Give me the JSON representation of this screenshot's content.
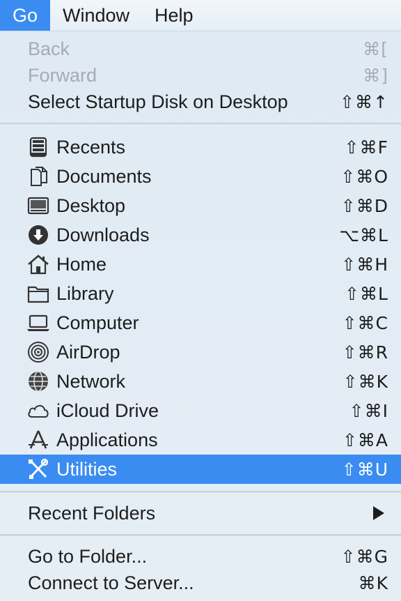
{
  "menubar": {
    "items": [
      "Go",
      "Window",
      "Help"
    ]
  },
  "menu": {
    "top_items": [
      {
        "label": "Back",
        "shortcut": "⌘[",
        "enabled": false
      },
      {
        "label": "Forward",
        "shortcut": "⌘]",
        "enabled": false
      },
      {
        "label": "Select Startup Disk on Desktop",
        "shortcut": "⇧⌘↑",
        "enabled": true
      }
    ],
    "places": [
      {
        "label": "Recents",
        "shortcut": "⇧⌘F",
        "icon": "recents-icon"
      },
      {
        "label": "Documents",
        "shortcut": "⇧⌘O",
        "icon": "documents-icon"
      },
      {
        "label": "Desktop",
        "shortcut": "⇧⌘D",
        "icon": "desktop-icon"
      },
      {
        "label": "Downloads",
        "shortcut": "⌥⌘L",
        "icon": "downloads-icon"
      },
      {
        "label": "Home",
        "shortcut": "⇧⌘H",
        "icon": "home-icon"
      },
      {
        "label": "Library",
        "shortcut": "⇧⌘L",
        "icon": "folder-icon"
      },
      {
        "label": "Computer",
        "shortcut": "⇧⌘C",
        "icon": "computer-icon"
      },
      {
        "label": "AirDrop",
        "shortcut": "⇧⌘R",
        "icon": "airdrop-icon"
      },
      {
        "label": "Network",
        "shortcut": "⇧⌘K",
        "icon": "network-globe-icon"
      },
      {
        "label": "iCloud Drive",
        "shortcut": "⇧⌘I",
        "icon": "cloud-icon"
      },
      {
        "label": "Applications",
        "shortcut": "⇧⌘A",
        "icon": "applications-icon"
      },
      {
        "label": "Utilities",
        "shortcut": "⇧⌘U",
        "icon": "utilities-tools-icon",
        "selected": true
      }
    ],
    "recent_folders": {
      "label": "Recent Folders",
      "submenu": true
    },
    "bottom_items": [
      {
        "label": "Go to Folder...",
        "shortcut": "⇧⌘G"
      },
      {
        "label": "Connect to Server...",
        "shortcut": "⌘K"
      }
    ]
  },
  "colors": {
    "accent": "#3a8cf1",
    "menu_bg": "#e3edf5",
    "text": "#1d1d1d",
    "disabled_text": "#a6acb2"
  }
}
